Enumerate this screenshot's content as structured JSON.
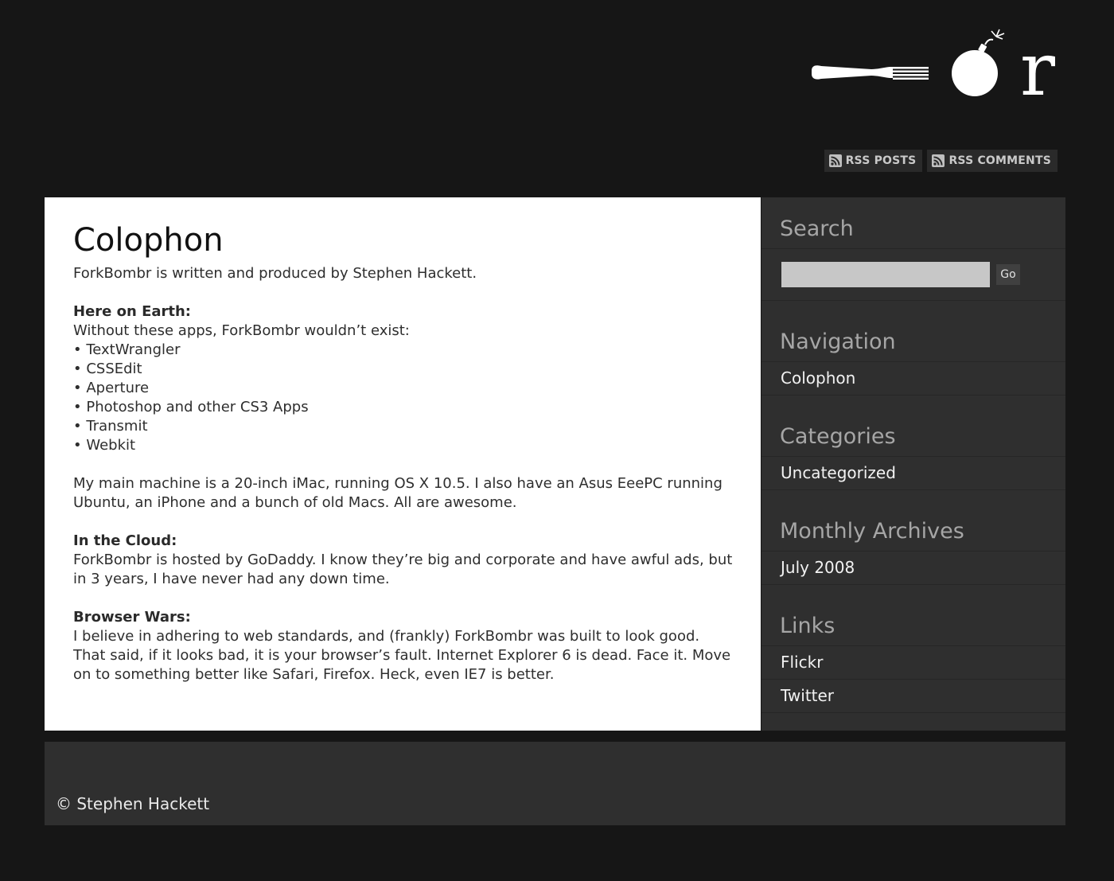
{
  "header": {
    "logo_alt": "ForkBombr",
    "rss_posts_label": "RSS POSTS",
    "rss_comments_label": "RSS COMMENTS"
  },
  "post": {
    "title": "Colophon",
    "intro": "ForkBombr is written and produced by Stephen Hackett.",
    "earth": {
      "heading": "Here on Earth:",
      "lead": "Without these apps, ForkBombr wouldn’t exist:",
      "apps": [
        "• TextWrangler",
        "• CSSEdit",
        "• Aperture",
        "• Photoshop and other CS3 Apps",
        "• Transmit",
        "• Webkit"
      ]
    },
    "machine_text": "My main machine is a 20-inch iMac, running OS X 10.5. I also have an Asus EeePC running Ubuntu, an iPhone and a bunch of old Macs. All are awesome.",
    "cloud": {
      "heading": "In the Cloud:",
      "text": "ForkBombr is hosted by GoDaddy. I know they’re big and corporate and have awful ads, but in 3 years, I have never had any down time."
    },
    "browser": {
      "heading": "Browser Wars:",
      "text": "I believe in adhering to web standards, and (frankly) ForkBombr was built to look good. That said, if it looks bad, it is your browser’s fault. Internet Explorer 6 is dead. Face it. Move on to something better like Safari, Firefox. Heck, even IE7 is better."
    }
  },
  "sidebar": {
    "search": {
      "title": "Search",
      "value": "",
      "button": "Go"
    },
    "navigation": {
      "title": "Navigation",
      "items": [
        "Colophon"
      ]
    },
    "categories": {
      "title": "Categories",
      "items": [
        "Uncategorized"
      ]
    },
    "archives": {
      "title": "Monthly Archives",
      "items": [
        "July 2008"
      ]
    },
    "links": {
      "title": "Links",
      "items": [
        "Flickr",
        "Twitter"
      ]
    }
  },
  "footer": {
    "copyright": "© Stephen Hackett"
  },
  "colors": {
    "page_bg": "#161616",
    "content_bg": "#ffffff",
    "sidebar_bg": "#2f2f2f",
    "widget_title": "#a6a6a6"
  }
}
